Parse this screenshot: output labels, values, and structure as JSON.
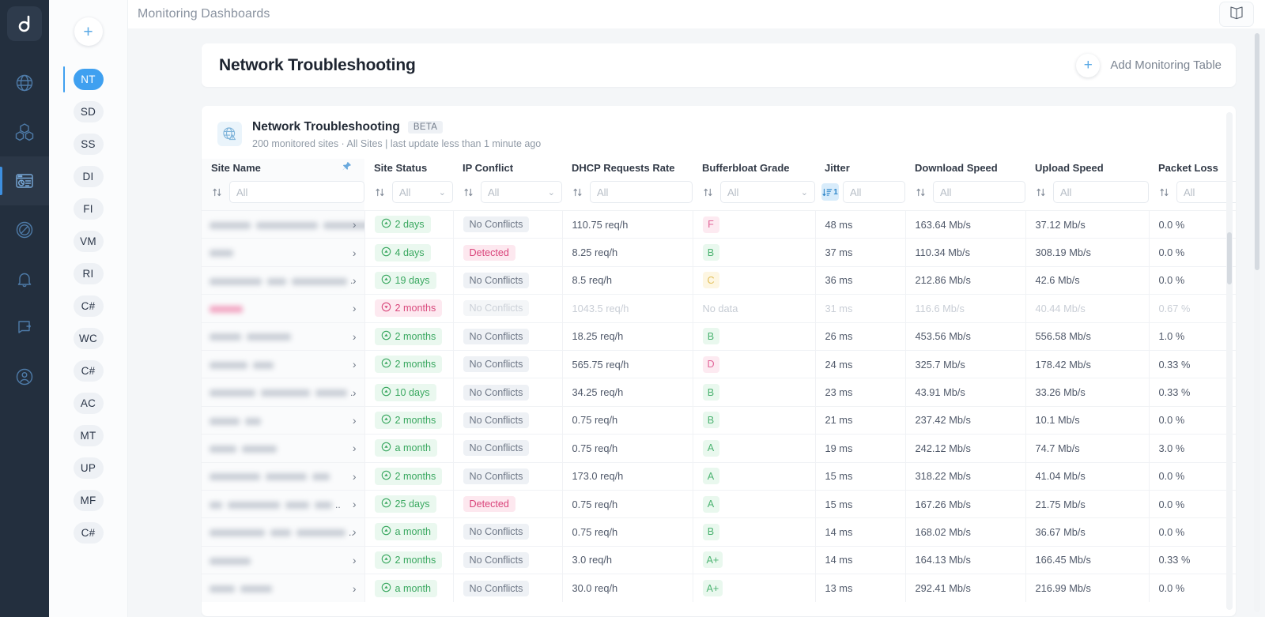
{
  "topbar": {
    "title": "Monitoring Dashboards",
    "book_icon": "book-icon"
  },
  "rail": {
    "logo": "d",
    "items": [
      {
        "name": "globe-network-icon",
        "active": false
      },
      {
        "name": "cubes-inventory-icon",
        "active": false
      },
      {
        "name": "dashboard-report-icon",
        "active": true
      },
      {
        "name": "compass-icon",
        "active": false
      },
      {
        "name": "bell-alerts-icon",
        "active": false
      },
      {
        "name": "logout-icon",
        "active": false
      },
      {
        "name": "user-account-icon",
        "active": false
      }
    ]
  },
  "dashrail": {
    "add_label": "+",
    "items": [
      {
        "initials": "NT",
        "active": true
      },
      {
        "initials": "SD",
        "active": false
      },
      {
        "initials": "SS",
        "active": false
      },
      {
        "initials": "DI",
        "active": false
      },
      {
        "initials": "FI",
        "active": false
      },
      {
        "initials": "VM",
        "active": false
      },
      {
        "initials": "RI",
        "active": false
      },
      {
        "initials": "C#",
        "active": false
      },
      {
        "initials": "WC",
        "active": false
      },
      {
        "initials": "C#",
        "active": false
      },
      {
        "initials": "AC",
        "active": false
      },
      {
        "initials": "MT",
        "active": false
      },
      {
        "initials": "UP",
        "active": false
      },
      {
        "initials": "MF",
        "active": false
      },
      {
        "initials": "C#",
        "active": false
      }
    ]
  },
  "page": {
    "title": "Network Troubleshooting",
    "add_table_label": "Add Monitoring Table"
  },
  "card": {
    "icon": "globe-warning-icon",
    "title": "Network Troubleshooting",
    "badge": "BETA",
    "subtitle": "200 monitored sites · All Sites | last update less than 1 minute ago"
  },
  "table": {
    "columns": [
      {
        "label": "Site Name",
        "filter": "All",
        "type": "text",
        "sort_active": false,
        "pinned": true
      },
      {
        "label": "Site Status",
        "filter": "All",
        "type": "select",
        "sort_active": false
      },
      {
        "label": "IP Conflict",
        "filter": "All",
        "type": "select",
        "sort_active": false
      },
      {
        "label": "DHCP Requests Rate",
        "filter": "All",
        "type": "text",
        "sort_active": false
      },
      {
        "label": "Bufferbloat Grade",
        "filter": "All",
        "type": "select",
        "sort_active": false
      },
      {
        "label": "Jitter",
        "filter": "All",
        "type": "text",
        "sort_active": true,
        "sort_order": "1"
      },
      {
        "label": "Download Speed",
        "filter": "All",
        "type": "text",
        "sort_active": false
      },
      {
        "label": "Upload Speed",
        "filter": "All",
        "type": "text",
        "sort_active": false
      },
      {
        "label": "Packet Loss",
        "filter": "All",
        "type": "text",
        "sort_active": false
      }
    ],
    "rows": [
      {
        "site_blurs": [
          52,
          78,
          80
        ],
        "site_trailing": ".",
        "status": "2 days",
        "status_dir": "up",
        "ip": "No Conflicts",
        "dhcp": "110.75 req/h",
        "grade": "F",
        "jitter": "48 ms",
        "download": "163.64 Mb/s",
        "upload": "37.12 Mb/s",
        "loss": "0.0 %",
        "dim": false
      },
      {
        "site_blurs": [
          30
        ],
        "site_trailing": "",
        "status": "4 days",
        "status_dir": "up",
        "ip": "Detected",
        "dhcp": "8.25 req/h",
        "grade": "B",
        "jitter": "37 ms",
        "download": "110.34 Mb/s",
        "upload": "308.19 Mb/s",
        "loss": "0.0 %",
        "dim": false
      },
      {
        "site_blurs": [
          66,
          24,
          70
        ],
        "site_trailing": ".",
        "status": "19 days",
        "status_dir": "up",
        "ip": "No Conflicts",
        "dhcp": "8.5 req/h",
        "grade": "C",
        "jitter": "36 ms",
        "download": "212.86 Mb/s",
        "upload": "42.6 Mb/s",
        "loss": "0.0 %",
        "dim": false
      },
      {
        "site_blurs": [
          42
        ],
        "site_trailing": "",
        "status": "2 months",
        "status_dir": "down",
        "ip": "No Conflicts",
        "dhcp": "1043.5 req/h",
        "grade": "No data",
        "jitter": "31 ms",
        "download": "116.6 Mb/s",
        "upload": "40.44 Mb/s",
        "loss": "0.67 %",
        "dim": true,
        "site_pink": true
      },
      {
        "site_blurs": [
          40,
          56
        ],
        "site_trailing": "",
        "status": "2 months",
        "status_dir": "up",
        "ip": "No Conflicts",
        "dhcp": "18.25 req/h",
        "grade": "B",
        "jitter": "26 ms",
        "download": "453.56 Mb/s",
        "upload": "556.58 Mb/s",
        "loss": "1.0 %",
        "dim": false
      },
      {
        "site_blurs": [
          48,
          26
        ],
        "site_trailing": "",
        "status": "2 months",
        "status_dir": "up",
        "ip": "No Conflicts",
        "dhcp": "565.75 req/h",
        "grade": "D",
        "jitter": "24 ms",
        "download": "325.7 Mb/s",
        "upload": "178.42 Mb/s",
        "loss": "0.33 %",
        "dim": false
      },
      {
        "site_blurs": [
          58,
          62,
          40
        ],
        "site_trailing": ".",
        "status": "10 days",
        "status_dir": "up",
        "ip": "No Conflicts",
        "dhcp": "34.25 req/h",
        "grade": "B",
        "jitter": "23 ms",
        "download": "43.91 Mb/s",
        "upload": "33.26 Mb/s",
        "loss": "0.33 %",
        "dim": false
      },
      {
        "site_blurs": [
          38,
          20
        ],
        "site_trailing": "",
        "status": "2 months",
        "status_dir": "up",
        "ip": "No Conflicts",
        "dhcp": "0.75 req/h",
        "grade": "B",
        "jitter": "21 ms",
        "download": "237.42 Mb/s",
        "upload": "10.1 Mb/s",
        "loss": "0.0 %",
        "dim": false
      },
      {
        "site_blurs": [
          34,
          44
        ],
        "site_trailing": "",
        "status": "a month",
        "status_dir": "up",
        "ip": "No Conflicts",
        "dhcp": "0.75 req/h",
        "grade": "A",
        "jitter": "19 ms",
        "download": "242.12 Mb/s",
        "upload": "74.7 Mb/s",
        "loss": "3.0 %",
        "dim": false
      },
      {
        "site_blurs": [
          64,
          52,
          22
        ],
        "site_trailing": "",
        "status": "2 months",
        "status_dir": "up",
        "ip": "No Conflicts",
        "dhcp": "173.0 req/h",
        "grade": "A",
        "jitter": "15 ms",
        "download": "318.22 Mb/s",
        "upload": "41.04 Mb/s",
        "loss": "0.0 %",
        "dim": false
      },
      {
        "site_blurs": [
          16,
          66,
          30,
          22
        ],
        "site_trailing": "..",
        "status": "25 days",
        "status_dir": "up",
        "ip": "Detected",
        "dhcp": "0.75 req/h",
        "grade": "A",
        "jitter": "15 ms",
        "download": "167.26 Mb/s",
        "upload": "21.75 Mb/s",
        "loss": "0.0 %",
        "dim": false
      },
      {
        "site_blurs": [
          70,
          26,
          62
        ],
        "site_trailing": "..",
        "status": "a month",
        "status_dir": "up",
        "ip": "No Conflicts",
        "dhcp": "0.75 req/h",
        "grade": "B",
        "jitter": "14 ms",
        "download": "168.02 Mb/s",
        "upload": "36.67 Mb/s",
        "loss": "0.0 %",
        "dim": false
      },
      {
        "site_blurs": [
          52
        ],
        "site_trailing": "",
        "status": "2 months",
        "status_dir": "up",
        "ip": "No Conflicts",
        "dhcp": "3.0 req/h",
        "grade": "A+",
        "jitter": "14 ms",
        "download": "164.13 Mb/s",
        "upload": "166.45 Mb/s",
        "loss": "0.33 %",
        "dim": false
      },
      {
        "site_blurs": [
          32,
          40
        ],
        "site_trailing": "",
        "status": "a month",
        "status_dir": "up",
        "ip": "No Conflicts",
        "dhcp": "30.0 req/h",
        "grade": "A+",
        "jitter": "13 ms",
        "download": "292.41 Mb/s",
        "upload": "216.99 Mb/s",
        "loss": "0.0 %",
        "dim": false
      }
    ]
  },
  "colors": {
    "rail_bg": "#232f3e",
    "accent_blue": "#3fa0f0",
    "green": "#3aa860",
    "pink": "#d9437a",
    "page_bg": "#f4f6f8"
  }
}
